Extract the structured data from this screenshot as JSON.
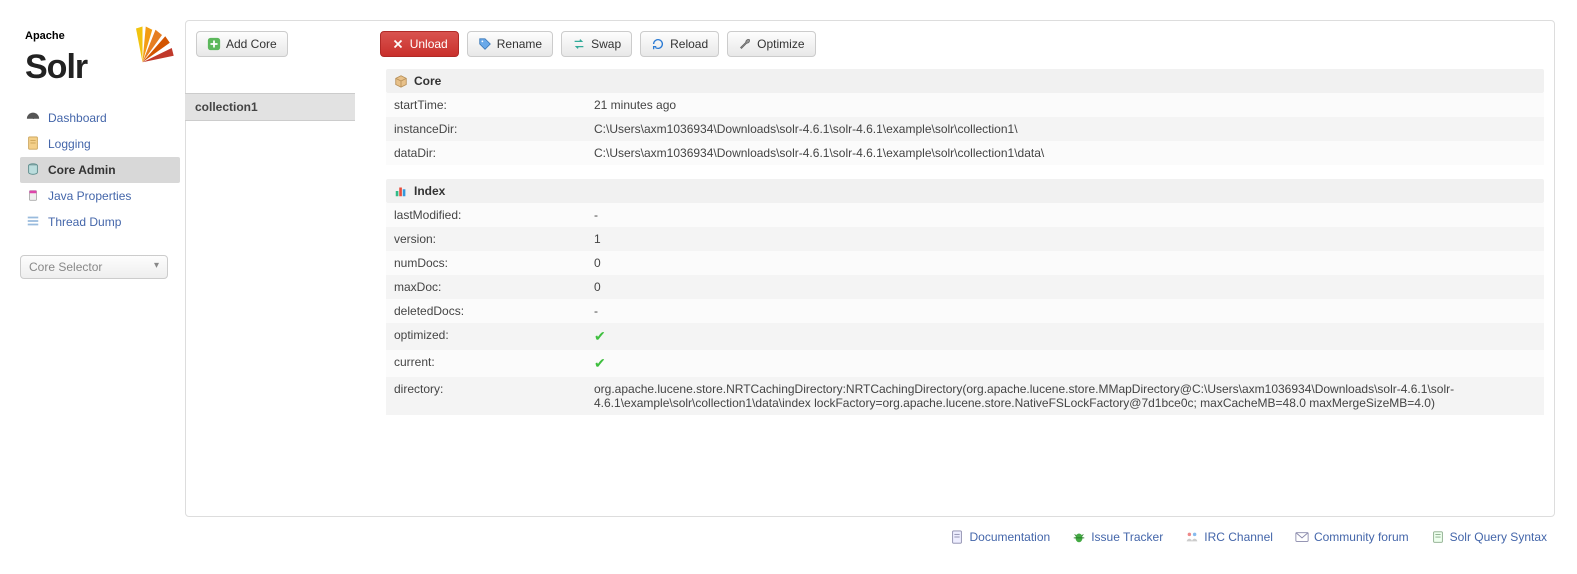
{
  "logo": {
    "apache": "Apache",
    "solr": "Solr"
  },
  "nav": {
    "dashboard": "Dashboard",
    "logging": "Logging",
    "core_admin": "Core Admin",
    "java_props": "Java Properties",
    "thread_dump": "Thread Dump"
  },
  "core_selector_label": "Core Selector",
  "toolbar": {
    "add_core": "Add Core",
    "unload": "Unload",
    "rename": "Rename",
    "swap": "Swap",
    "reload": "Reload",
    "optimize": "Optimize"
  },
  "cores": {
    "selected": "collection1"
  },
  "sections": {
    "core": {
      "title": "Core",
      "rows": {
        "startTime": {
          "k": "startTime:",
          "v": "21 minutes ago"
        },
        "instanceDir": {
          "k": "instanceDir:",
          "v": "C:\\Users\\axm1036934\\Downloads\\solr-4.6.1\\solr-4.6.1\\example\\solr\\collection1\\"
        },
        "dataDir": {
          "k": "dataDir:",
          "v": "C:\\Users\\axm1036934\\Downloads\\solr-4.6.1\\solr-4.6.1\\example\\solr\\collection1\\data\\"
        }
      }
    },
    "index": {
      "title": "Index",
      "rows": {
        "lastModified": {
          "k": "lastModified:",
          "v": "-"
        },
        "version": {
          "k": "version:",
          "v": "1"
        },
        "numDocs": {
          "k": "numDocs:",
          "v": "0"
        },
        "maxDoc": {
          "k": "maxDoc:",
          "v": "0"
        },
        "deletedDocs": {
          "k": "deletedDocs:",
          "v": "-"
        },
        "optimized": {
          "k": "optimized:",
          "v": "✔"
        },
        "current": {
          "k": "current:",
          "v": "✔"
        },
        "directory": {
          "k": "directory:",
          "v": "org.apache.lucene.store.NRTCachingDirectory:NRTCachingDirectory(org.apache.lucene.store.MMapDirectory@C:\\Users\\axm1036934\\Downloads\\solr-4.6.1\\solr-4.6.1\\example\\solr\\collection1\\data\\index lockFactory=org.apache.lucene.store.NativeFSLockFactory@7d1bce0c; maxCacheMB=48.0 maxMergeSizeMB=4.0)"
        }
      }
    }
  },
  "footer": {
    "documentation": "Documentation",
    "issue_tracker": "Issue Tracker",
    "irc_channel": "IRC Channel",
    "community_forum": "Community forum",
    "query_syntax": "Solr Query Syntax"
  }
}
